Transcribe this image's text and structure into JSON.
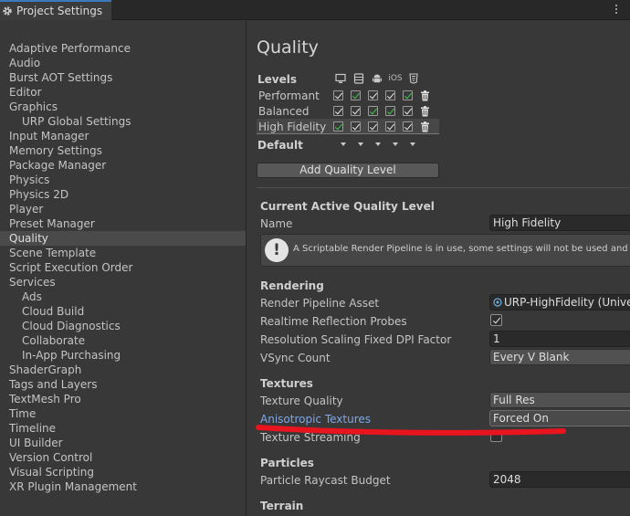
{
  "window": {
    "tab_title": "Project Settings"
  },
  "sidebar": {
    "items": [
      {
        "label": "Adaptive Performance",
        "sub": false
      },
      {
        "label": "Audio",
        "sub": false
      },
      {
        "label": "Burst AOT Settings",
        "sub": false
      },
      {
        "label": "Editor",
        "sub": false
      },
      {
        "label": "Graphics",
        "sub": false
      },
      {
        "label": "URP Global Settings",
        "sub": true
      },
      {
        "label": "Input Manager",
        "sub": false
      },
      {
        "label": "Memory Settings",
        "sub": false
      },
      {
        "label": "Package Manager",
        "sub": false
      },
      {
        "label": "Physics",
        "sub": false
      },
      {
        "label": "Physics 2D",
        "sub": false
      },
      {
        "label": "Player",
        "sub": false
      },
      {
        "label": "Preset Manager",
        "sub": false
      },
      {
        "label": "Quality",
        "sub": false,
        "active": true
      },
      {
        "label": "Scene Template",
        "sub": false
      },
      {
        "label": "Script Execution Order",
        "sub": false
      },
      {
        "label": "Services",
        "sub": false
      },
      {
        "label": "Ads",
        "sub": true
      },
      {
        "label": "Cloud Build",
        "sub": true
      },
      {
        "label": "Cloud Diagnostics",
        "sub": true
      },
      {
        "label": "Collaborate",
        "sub": true
      },
      {
        "label": "In-App Purchasing",
        "sub": true
      },
      {
        "label": "ShaderGraph",
        "sub": false
      },
      {
        "label": "Tags and Layers",
        "sub": false
      },
      {
        "label": "TextMesh Pro",
        "sub": false
      },
      {
        "label": "Time",
        "sub": false
      },
      {
        "label": "Timeline",
        "sub": false
      },
      {
        "label": "UI Builder",
        "sub": false
      },
      {
        "label": "Version Control",
        "sub": false
      },
      {
        "label": "Visual Scripting",
        "sub": false
      },
      {
        "label": "XR Plugin Management",
        "sub": false
      }
    ]
  },
  "main": {
    "title": "Quality",
    "levels_header": "Levels",
    "platforms": [
      "desktop-icon",
      "console-icon",
      "android-icon",
      "iOS",
      "html5-icon"
    ],
    "levels": [
      {
        "name": "Performant",
        "checks": [
          "w",
          "g",
          "w",
          "w",
          "g"
        ]
      },
      {
        "name": "Balanced",
        "checks": [
          "w",
          "w",
          "g",
          "g",
          "w"
        ]
      },
      {
        "name": "High Fidelity",
        "checks": [
          "g",
          "w",
          "w",
          "w",
          "w"
        ]
      }
    ],
    "default_label": "Default",
    "add_level_label": "Add Quality Level",
    "current": {
      "header": "Current Active Quality Level",
      "name_label": "Name",
      "name_value": "High Fidelity",
      "help_text": "A Scriptable Render Pipeline is in use, some settings will not be used and are hidden"
    },
    "rendering": {
      "header": "Rendering",
      "pipeline_label": "Render Pipeline Asset",
      "pipeline_value": "URP-HighFidelity (Universal Render Pipeline Asset)",
      "reflection_label": "Realtime Reflection Probes",
      "reflection_on": true,
      "dpi_label": "Resolution Scaling Fixed DPI Factor",
      "dpi_value": "1",
      "vsync_label": "VSync Count",
      "vsync_value": "Every V Blank"
    },
    "textures": {
      "header": "Textures",
      "quality_label": "Texture Quality",
      "quality_value": "Full Res",
      "aniso_label": "Anisotropic Textures",
      "aniso_value": "Forced On",
      "streaming_label": "Texture Streaming"
    },
    "particles": {
      "header": "Particles",
      "budget_label": "Particle Raycast Budget",
      "budget_value": "2048"
    },
    "terrain": {
      "header": "Terrain"
    }
  },
  "colors": {
    "accent_blue": "#3a79bb",
    "link_blue": "#7fa7e6",
    "check_green": "#3ec94a",
    "annotation_red": "#e8141e"
  }
}
